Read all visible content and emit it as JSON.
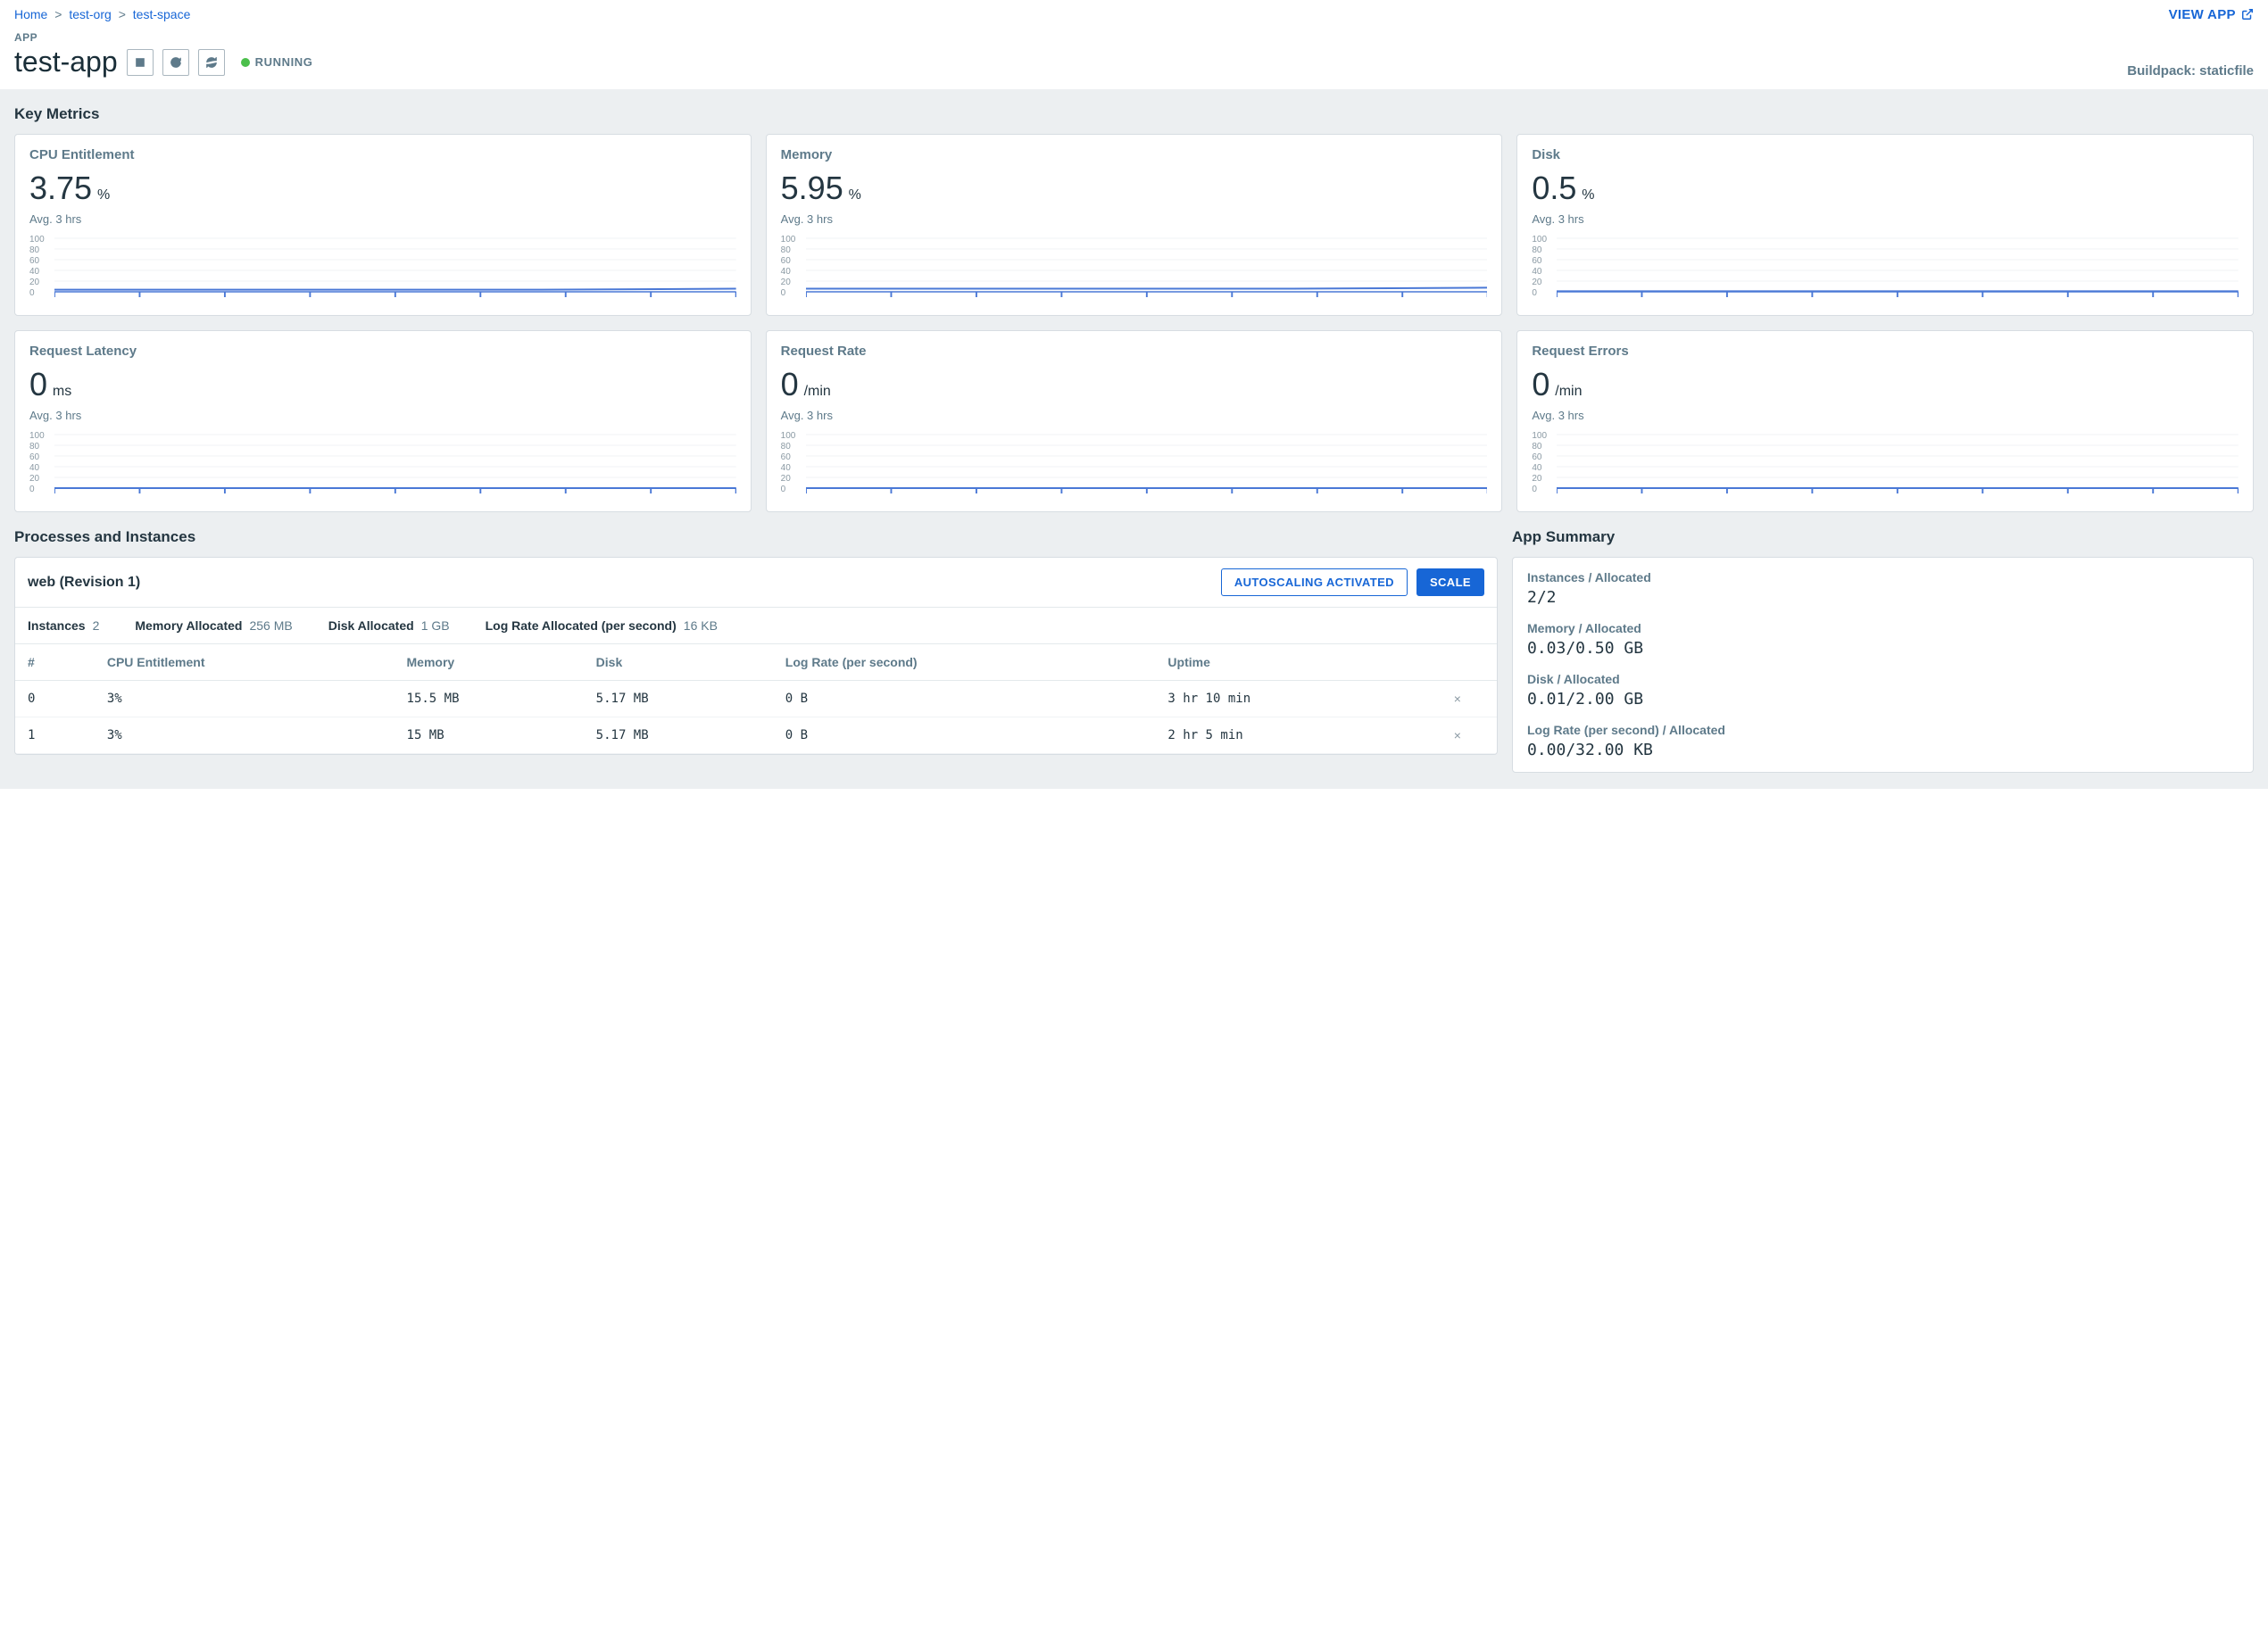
{
  "breadcrumb": {
    "home": "Home",
    "org": "test-org",
    "space": "test-space"
  },
  "view_app": "VIEW APP",
  "header": {
    "label": "APP",
    "title": "test-app",
    "status": "RUNNING",
    "buildpack": "Buildpack: staticfile"
  },
  "key_metrics_title": "Key Metrics",
  "metrics": [
    {
      "label": "CPU Entitlement",
      "value": "3.75",
      "unit": "%",
      "sub": "Avg. 3 hrs"
    },
    {
      "label": "Memory",
      "value": "5.95",
      "unit": "%",
      "sub": "Avg. 3 hrs"
    },
    {
      "label": "Disk",
      "value": "0.5",
      "unit": "%",
      "sub": "Avg. 3 hrs"
    },
    {
      "label": "Request Latency",
      "value": "0",
      "unit": "ms",
      "sub": "Avg. 3 hrs"
    },
    {
      "label": "Request Rate",
      "value": "0",
      "unit": "/min",
      "sub": "Avg. 3 hrs"
    },
    {
      "label": "Request Errors",
      "value": "0",
      "unit": "/min",
      "sub": "Avg. 3 hrs"
    }
  ],
  "spark_ticks": [
    "100",
    "80",
    "60",
    "40",
    "20",
    "0"
  ],
  "processes": {
    "section_title": "Processes and Instances",
    "title": "web (Revision 1)",
    "autoscaling_btn": "AUTOSCALING ACTIVATED",
    "scale_btn": "SCALE",
    "alloc": {
      "instances_l": "Instances",
      "instances_v": "2",
      "mem_l": "Memory Allocated",
      "mem_v": "256 MB",
      "disk_l": "Disk Allocated",
      "disk_v": "1 GB",
      "log_l": "Log Rate Allocated (per second)",
      "log_v": "16 KB"
    },
    "cols": {
      "num": "#",
      "cpu": "CPU Entitlement",
      "mem": "Memory",
      "disk": "Disk",
      "log": "Log Rate (per second)",
      "uptime": "Uptime"
    },
    "rows": [
      {
        "num": "0",
        "cpu": "3%",
        "mem": "15.5 MB",
        "disk": "5.17 MB",
        "log": "0 B",
        "uptime": "3 hr 10 min"
      },
      {
        "num": "1",
        "cpu": "3%",
        "mem": "15 MB",
        "disk": "5.17 MB",
        "log": "0 B",
        "uptime": "2 hr 5 min"
      }
    ]
  },
  "summary": {
    "title": "App Summary",
    "items": [
      {
        "label": "Instances / Allocated",
        "value": "2/2"
      },
      {
        "label": "Memory / Allocated",
        "value": "0.03/0.50 GB"
      },
      {
        "label": "Disk / Allocated",
        "value": "0.01/2.00 GB"
      },
      {
        "label": "Log Rate (per second) / Allocated",
        "value": "0.00/32.00 KB"
      }
    ]
  },
  "chart_data": [
    {
      "type": "line",
      "title": "CPU Entitlement",
      "ylim": [
        0,
        100
      ],
      "yticks": [
        0,
        20,
        40,
        60,
        80,
        100
      ],
      "values": [
        4,
        4,
        4,
        4,
        4,
        4,
        5,
        6
      ]
    },
    {
      "type": "line",
      "title": "Memory",
      "ylim": [
        0,
        100
      ],
      "yticks": [
        0,
        20,
        40,
        60,
        80,
        100
      ],
      "values": [
        6,
        6,
        6,
        6,
        6,
        6,
        7,
        8
      ]
    },
    {
      "type": "line",
      "title": "Disk",
      "ylim": [
        0,
        100
      ],
      "yticks": [
        0,
        20,
        40,
        60,
        80,
        100
      ],
      "values": [
        1,
        1,
        1,
        1,
        1,
        1,
        1,
        1
      ]
    },
    {
      "type": "line",
      "title": "Request Latency",
      "ylim": [
        0,
        100
      ],
      "yticks": [
        0,
        20,
        40,
        60,
        80,
        100
      ],
      "values": [
        0,
        0,
        0,
        0,
        0,
        0,
        0,
        0
      ]
    },
    {
      "type": "line",
      "title": "Request Rate",
      "ylim": [
        0,
        100
      ],
      "yticks": [
        0,
        20,
        40,
        60,
        80,
        100
      ],
      "values": [
        0,
        0,
        0,
        0,
        0,
        0,
        0,
        0
      ]
    },
    {
      "type": "line",
      "title": "Request Errors",
      "ylim": [
        0,
        100
      ],
      "yticks": [
        0,
        20,
        40,
        60,
        80,
        100
      ],
      "values": [
        0,
        0,
        0,
        0,
        0,
        0,
        0,
        0
      ]
    }
  ]
}
